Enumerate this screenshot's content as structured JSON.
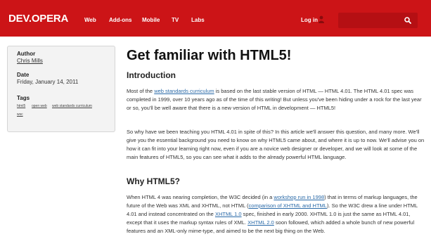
{
  "header": {
    "logo": "DEV.OPERA",
    "nav": [
      "Web",
      "Add-ons",
      "Mobile",
      "TV",
      "Labs"
    ],
    "login": "Log in",
    "search_placeholder": ""
  },
  "sidebar": {
    "author_label": "Author",
    "author_name": "Chris Mills",
    "date_label": "Date",
    "date_value": "Friday, January 14, 2011",
    "tags_label": "Tags",
    "tags": [
      "html5",
      "open web",
      "web standards curriculum",
      "wsc"
    ]
  },
  "article": {
    "title": "Get familiar with HTML5!",
    "intro_heading": "Introduction",
    "p1": {
      "a": "Most of the ",
      "link1": "web standards curriculum",
      "b": " is based on the last stable version of HTML — HTML 4.01. The HTML 4.01 spec was completed in 1999, over 10 years ago as of the time of this writing! But unless you've been hiding under a rock for the last year or so, you'll be well aware that there is a new version of HTML in development — HTML5!"
    },
    "p2": "So why have we been teaching you HTML 4.01 in spite of this? In this article we'll answer this question, and many more. We'll give you the essential background you need to know on why HTML5 came about, and where it is up to now. We'll advise you on how it can fit into your learning right now, even if you are a novice web designer or developer, and we will look at some of the main features of HTML5, so you can see what it adds to the already powerful HTML language.",
    "why_heading": "Why HTML5?",
    "p3": {
      "a": "When HTML 4 was nearing completion, the W3C decided (in a ",
      "link1": "workshop run in 1998",
      "b": ") that in terms of markup languages, the future of the Web was XML and XHTML, not HTML (",
      "link2": "comparison of XHTML and HTML",
      "c": "). So the W3C drew a line under HTML 4.01 and instead concentrated on the ",
      "link3": "XHTML 1.0",
      "d": " spec, finished in early 2000. XHTML 1.0 is just the same as HTML 4.01, except that it uses the markup syntax rules of XML. ",
      "link4": "XHTML 2.0",
      "e": " soon followed, which added a whole bunch of new powerful features and an XML-only mime-type, and aimed to be the next big thing on the Web."
    }
  },
  "colors": {
    "brand_red": "#cc1417",
    "link_blue": "#2a6aa8"
  }
}
